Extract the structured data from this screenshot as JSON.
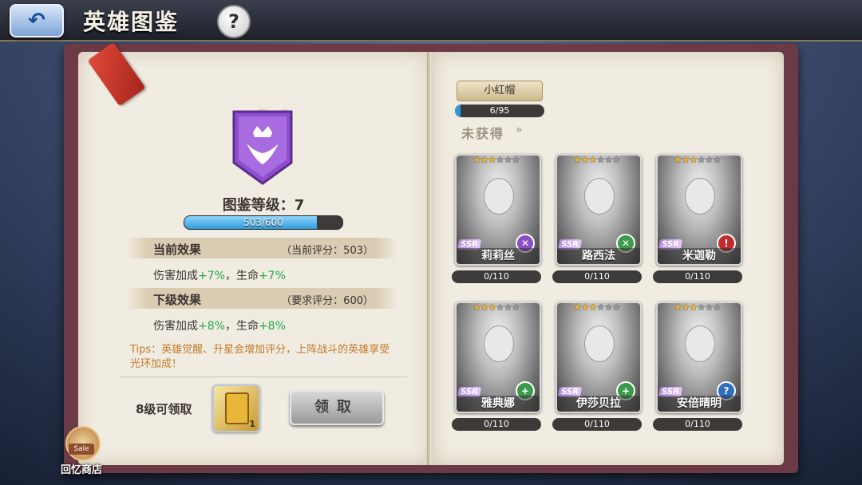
{
  "header": {
    "title": "英雄图鉴",
    "back_icon": "back-arrow-icon",
    "help_icon_text": "?"
  },
  "left_page": {
    "level_text": "图鉴等级：7",
    "level_progress": {
      "current": 503,
      "max": 600,
      "label": "503/600"
    },
    "current_effect": {
      "title": "当前效果",
      "rating": "（当前评分：503）",
      "line_prefix": "伤害加成",
      "line_value1": "+7%",
      "line_mid": "，生命",
      "line_value2": "+7%"
    },
    "next_effect": {
      "title": "下级效果",
      "rating": "（要求评分：600）",
      "line_prefix": "伤害加成",
      "line_value1": "+8%",
      "line_mid": "，生命",
      "line_value2": "+8%"
    },
    "tips": "Tips：英雄觉醒、升星会增加评分，上阵战斗的英雄享受光环加成！",
    "claim_label": "8级可领取",
    "reward_qty": "1",
    "claim_button": "领取",
    "shop_badge": "Sale",
    "shop_label": "回忆商店"
  },
  "right_page": {
    "previous_hero": {
      "name": "小红帽",
      "progress_label": "6/95",
      "progress_value": 0.063
    },
    "section_label": "未获得",
    "section_arrow": "»",
    "heroes": [
      {
        "name": "莉莉丝",
        "rarity": "SSR",
        "stars_on": 3,
        "stars_total": 6,
        "progress": "0/110",
        "faction_color": "#8a4fc4",
        "faction_icon": "sword-cross-icon",
        "faction_symbol": "✕"
      },
      {
        "name": "路西法",
        "rarity": "SSR",
        "stars_on": 3,
        "stars_total": 6,
        "progress": "0/110",
        "faction_color": "#3c9a4a",
        "faction_icon": "sword-cross-icon",
        "faction_symbol": "✕"
      },
      {
        "name": "米迦勒",
        "rarity": "SSR",
        "stars_on": 3,
        "stars_total": 6,
        "progress": "0/110",
        "faction_color": "#c22c2c",
        "faction_icon": "exclamation-icon",
        "faction_symbol": "!"
      },
      {
        "name": "雅典娜",
        "rarity": "SSR",
        "stars_on": 3,
        "stars_total": 6,
        "progress": "0/110",
        "faction_color": "#3c9a4a",
        "faction_icon": "plus-icon",
        "faction_symbol": "+"
      },
      {
        "name": "伊莎贝拉",
        "rarity": "SSR",
        "stars_on": 3,
        "stars_total": 6,
        "progress": "0/110",
        "faction_color": "#3c9a4a",
        "faction_icon": "plus-icon",
        "faction_symbol": "+"
      },
      {
        "name": "安倍晴明",
        "rarity": "SSR",
        "stars_on": 3,
        "stars_total": 6,
        "progress": "0/110",
        "faction_color": "#2f6fc0",
        "faction_icon": "question-icon",
        "faction_symbol": "?"
      }
    ]
  },
  "colors": {
    "accent_green": "#22a84a",
    "tips_orange": "#c27a2b",
    "progress_blue": "#2f9ad9",
    "book_cover": "#6b3a45"
  }
}
